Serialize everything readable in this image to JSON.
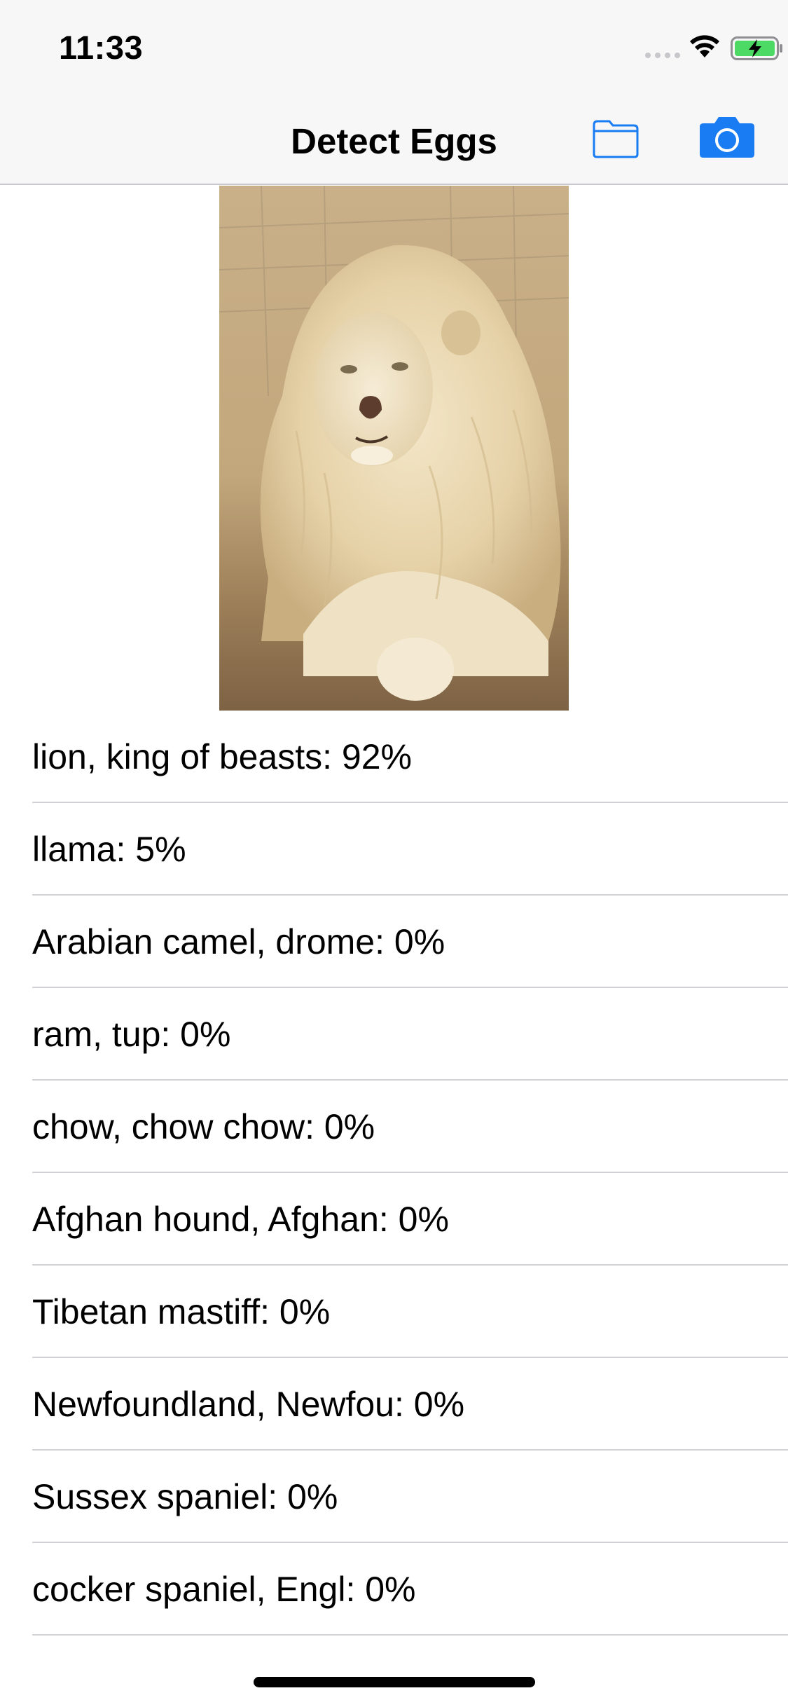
{
  "status_bar": {
    "time": "11:33",
    "icons": [
      "cellular-signal-icon",
      "wifi-icon",
      "battery-charging-icon"
    ]
  },
  "nav": {
    "title": "Detect Eggs",
    "buttons": [
      {
        "name": "folder-button",
        "icon": "folder-icon"
      },
      {
        "name": "camera-button",
        "icon": "camera-icon"
      }
    ]
  },
  "photo": {
    "subject": "white lion"
  },
  "results": [
    {
      "label": "lion, king of beasts: 92%"
    },
    {
      "label": "llama: 5%"
    },
    {
      "label": "Arabian camel, drome: 0%"
    },
    {
      "label": "ram, tup: 0%"
    },
    {
      "label": "chow, chow chow: 0%"
    },
    {
      "label": "Afghan hound, Afghan: 0%"
    },
    {
      "label": "Tibetan mastiff: 0%"
    },
    {
      "label": "Newfoundland, Newfou: 0%"
    },
    {
      "label": "Sussex spaniel: 0%"
    },
    {
      "label": "cocker spaniel, Engl: 0%"
    }
  ],
  "colors": {
    "tint": "#1a7cf3",
    "bar_background": "#f7f7f7",
    "separator": "#d1d1d6",
    "battery_green": "#4cd964"
  }
}
